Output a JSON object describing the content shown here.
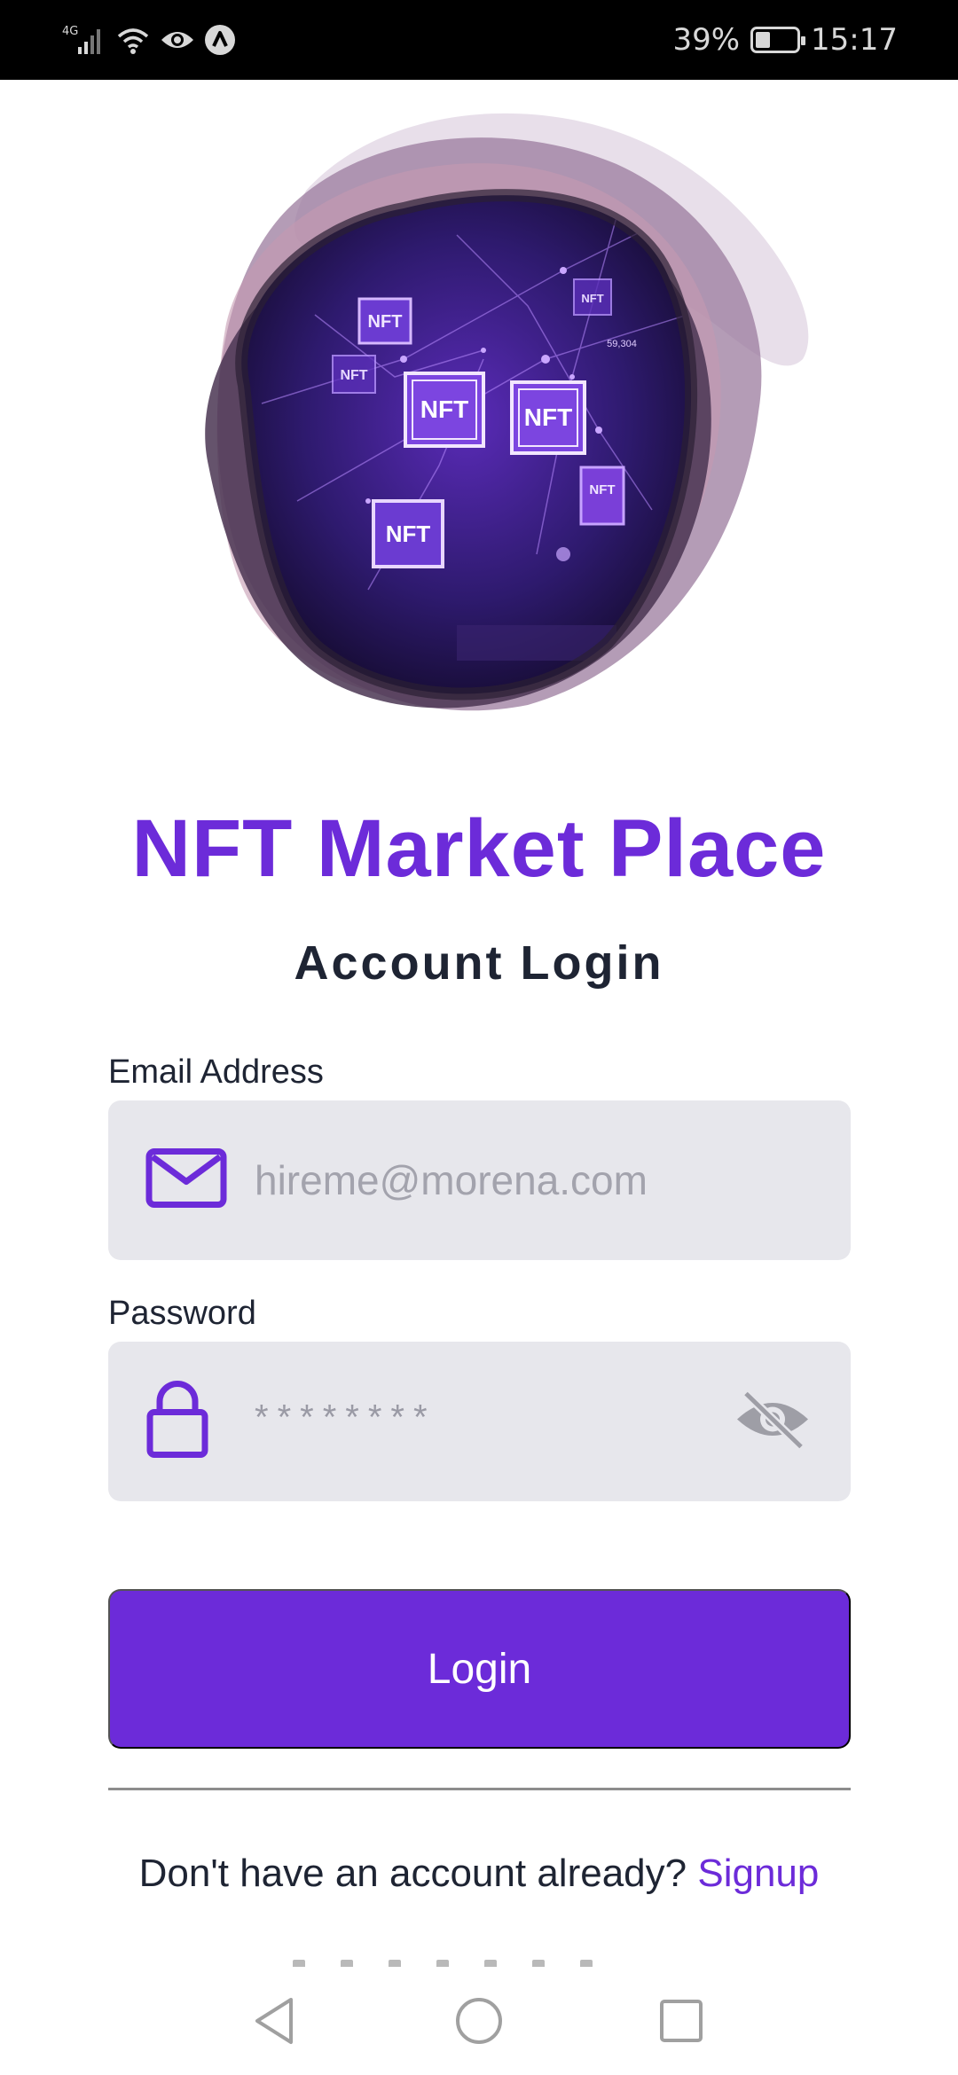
{
  "status_bar": {
    "network": "4G",
    "battery": "39%",
    "time": "15:17"
  },
  "hero": {
    "nft_tags": [
      "NFT",
      "NFT",
      "NFT",
      "NFT",
      "NFT",
      "NFT",
      "NFT"
    ],
    "price_tag": "59,304"
  },
  "app_title": "NFT Market Place",
  "login_title": "Account Login",
  "email": {
    "label": "Email Address",
    "placeholder": "hireme@morena.com"
  },
  "password": {
    "label": "Password",
    "value": "********"
  },
  "login_button": "Login",
  "signup": {
    "prompt": "Don't have an account already?",
    "link": "Signup"
  },
  "colors": {
    "accent": "#6c2bd9",
    "field_bg": "#e7e7ec",
    "text_dark": "#1e2433"
  }
}
